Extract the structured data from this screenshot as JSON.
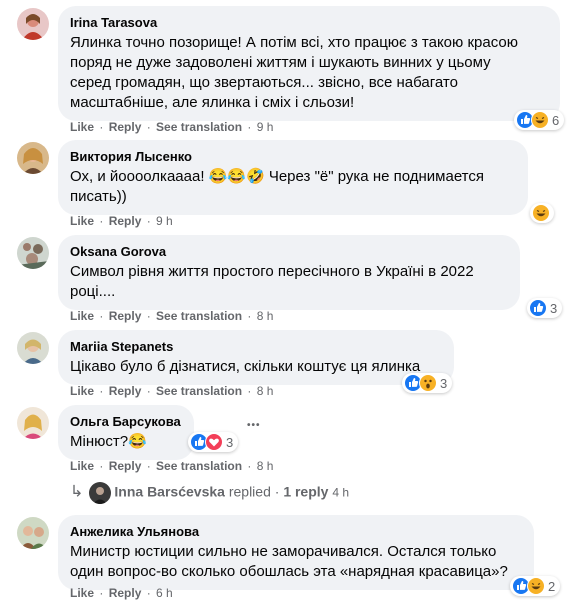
{
  "colors": {
    "bubble": "#f0f2f5",
    "meta": "#65676b",
    "like_blue": "#1877f2",
    "love_red": "#f33e58",
    "haha_yellow": "#f7b125"
  },
  "comments": [
    {
      "author": "Irina Tarasova",
      "lines": [
        "Ялинка точно позорище! А потім всі, хто працює з такою красою",
        "поряд не дуже задоволені життям і шукають винних у цьому",
        "серед громадян, що звертаються... звісно, все набагато",
        "масштабніше, але ялинка і сміх і сльози!"
      ],
      "actions": [
        "Like",
        "Reply",
        "See translation"
      ],
      "time": "9 h",
      "reactions": [
        "like-icon",
        "haha-icon"
      ],
      "reaction_count": "6"
    },
    {
      "author": "Виктория Лысенко",
      "lines": [
        "Ох, и йоооолкаааа! 😂😂🤣 Через \"ё\" рука не поднимается",
        "писать))"
      ],
      "actions": [
        "Like",
        "Reply"
      ],
      "time": "9 h",
      "reactions": [
        "haha-icon"
      ],
      "reaction_count": ""
    },
    {
      "author": "Oksana Gorova",
      "lines": [
        "Символ рівня життя простого пересічного в Україні в 2022",
        "році...."
      ],
      "actions": [
        "Like",
        "Reply",
        "See translation"
      ],
      "time": "8 h",
      "reactions": [
        "like-icon"
      ],
      "reaction_count": "3"
    },
    {
      "author": "Mariia Stepanets",
      "lines": [
        "Цікаво було б дізнатися, скільки коштує ця ялинка"
      ],
      "actions": [
        "Like",
        "Reply",
        "See translation"
      ],
      "time": "8 h",
      "reactions": [
        "like-icon",
        "wow-icon"
      ],
      "reaction_count": "3"
    },
    {
      "author": "Ольга Барсукова",
      "lines": [
        "Мінюст?😂"
      ],
      "actions": [
        "Like",
        "Reply",
        "See translation"
      ],
      "time": "8 h",
      "reactions": [
        "like-icon",
        "love-icon"
      ],
      "reaction_count": "3",
      "more": "•••"
    },
    {
      "author": "Анжелика Ульянова",
      "lines": [
        "Министр юстиции сильно не заморачивался. Остался только",
        "один вопрос-во сколько обошлась эта «нарядная красавица»?"
      ],
      "actions": [
        "Like",
        "Reply"
      ],
      "time": "6 h",
      "reactions": [
        "like-icon",
        "haha-icon"
      ],
      "reaction_count": "2"
    }
  ],
  "reply_thread": {
    "arrow": "↳",
    "name": "Inna Barsćevska",
    "replied": "replied",
    "sep": "·",
    "count": "1 reply",
    "time": "4 h"
  },
  "sep": "·"
}
